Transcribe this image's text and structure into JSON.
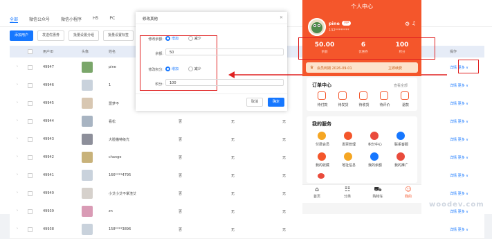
{
  "tabs": [
    "全部",
    "微信公众号",
    "微信小程序",
    "H5",
    "PC"
  ],
  "toolbar": {
    "add": "添加用户",
    "coupon": "发送优惠券",
    "group": "批量设置分组",
    "label": "批量设置标签"
  },
  "table": {
    "headers": [
      "用户ID",
      "头像",
      "姓名",
      "操作"
    ],
    "rows": [
      {
        "id": "49947",
        "name": "pine",
        "col3": "",
        "col4": "",
        "col5": "",
        "avatar": "#7aa66a"
      },
      {
        "id": "49946",
        "name": "1",
        "col3": "",
        "col4": "",
        "col5": "",
        "avatar": "#c9d2dc"
      },
      {
        "id": "49945",
        "name": "噩梦不",
        "col3": "",
        "col4": "",
        "col5": "",
        "avatar": "#d8c7b2"
      },
      {
        "id": "49944",
        "name": "看松",
        "col3": "否",
        "col4": "无",
        "col5": "无",
        "avatar": "#a8b4c2"
      },
      {
        "id": "49943",
        "name": "大脸猫特级光",
        "col3": "否",
        "col4": "无",
        "col5": "无",
        "avatar": "#8d8f9a"
      },
      {
        "id": "49942",
        "name": "change",
        "col3": "否",
        "col4": "无",
        "col5": "无",
        "avatar": "#c8b27a"
      },
      {
        "id": "49941",
        "name": "166****4795",
        "col3": "否",
        "col4": "无",
        "col5": "无",
        "avatar": "#c9d2dc"
      },
      {
        "id": "49940",
        "name": "小艾小艾不掌渣艾",
        "col3": "否",
        "col4": "无",
        "col5": "无",
        "avatar": "#d6d1cc"
      },
      {
        "id": "49939",
        "name": "zn",
        "col3": "否",
        "col4": "无",
        "col5": "无",
        "avatar": "#d99bb5"
      },
      {
        "id": "49938",
        "name": "158****3896",
        "col3": "否",
        "col4": "无",
        "col5": "无",
        "avatar": "#c9d2dc"
      }
    ],
    "op_detail": "详情",
    "op_more": "更多"
  },
  "modal": {
    "title": "修改其他",
    "balance_op_label": "修改余额:",
    "add": "增加",
    "reduce": "减少",
    "balance_label": "余额:",
    "balance_value": "50",
    "points_op_label": "修改积分:",
    "points_label": "积分:",
    "points_value": "100",
    "cancel": "取消",
    "confirm": "确定"
  },
  "phone": {
    "title": "个人中心",
    "name": "pine",
    "vip": "VIP",
    "phone": "132********",
    "stats": [
      {
        "value": "50.00",
        "label": "余额"
      },
      {
        "value": "6",
        "label": "优惠券"
      },
      {
        "value": "100",
        "label": "积分"
      }
    ],
    "vip_expire": "会员到期 2026-09-01",
    "vip_renew": "立即续费",
    "orders_title": "订单中心",
    "orders_all": "查看全部",
    "orders": [
      "待付款",
      "待发货",
      "待收货",
      "待评价",
      "退款"
    ],
    "services_title": "我的服务",
    "services": [
      "付费会员",
      "发票管理",
      "积分中心",
      "联系客服",
      "我的收藏",
      "地址信息",
      "我的余额",
      "我的推广"
    ],
    "tabbar": [
      "首页",
      "分类",
      "购物车",
      "我的"
    ]
  },
  "watermark": "woodev.com",
  "colors": {
    "primary": "#1677ff",
    "phone_orange": "#f4562b",
    "highlight": "#e02020"
  }
}
